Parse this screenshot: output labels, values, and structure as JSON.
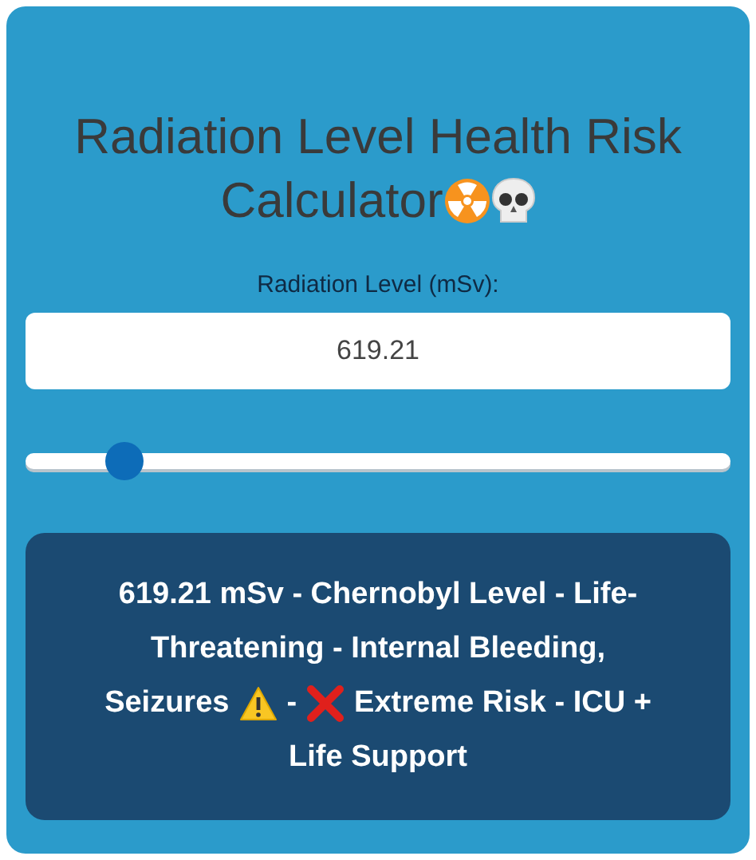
{
  "title": {
    "lines": [
      "Radiation Level Health Risk",
      "Calculator"
    ],
    "icons": [
      {
        "kind": "radiation"
      },
      {
        "kind": "skull"
      }
    ]
  },
  "field": {
    "label": "Radiation Level (mSv):",
    "value": "619.21"
  },
  "slider": {
    "level": 0.14
  },
  "result": [
    [
      {
        "kind": "text",
        "text": "619.21 mSv - Chernobyl Level - Life-"
      }
    ],
    [
      {
        "kind": "text",
        "text": "Threatening - Internal Bleeding,"
      }
    ],
    [
      {
        "kind": "text",
        "text": "Seizures"
      },
      {
        "kind": "warning"
      },
      {
        "kind": "text",
        "text": "-"
      },
      {
        "kind": "cross"
      },
      {
        "kind": "text",
        "text": "Extreme Risk - ICU +"
      }
    ],
    [
      {
        "kind": "text",
        "text": "Life Support"
      }
    ]
  ]
}
